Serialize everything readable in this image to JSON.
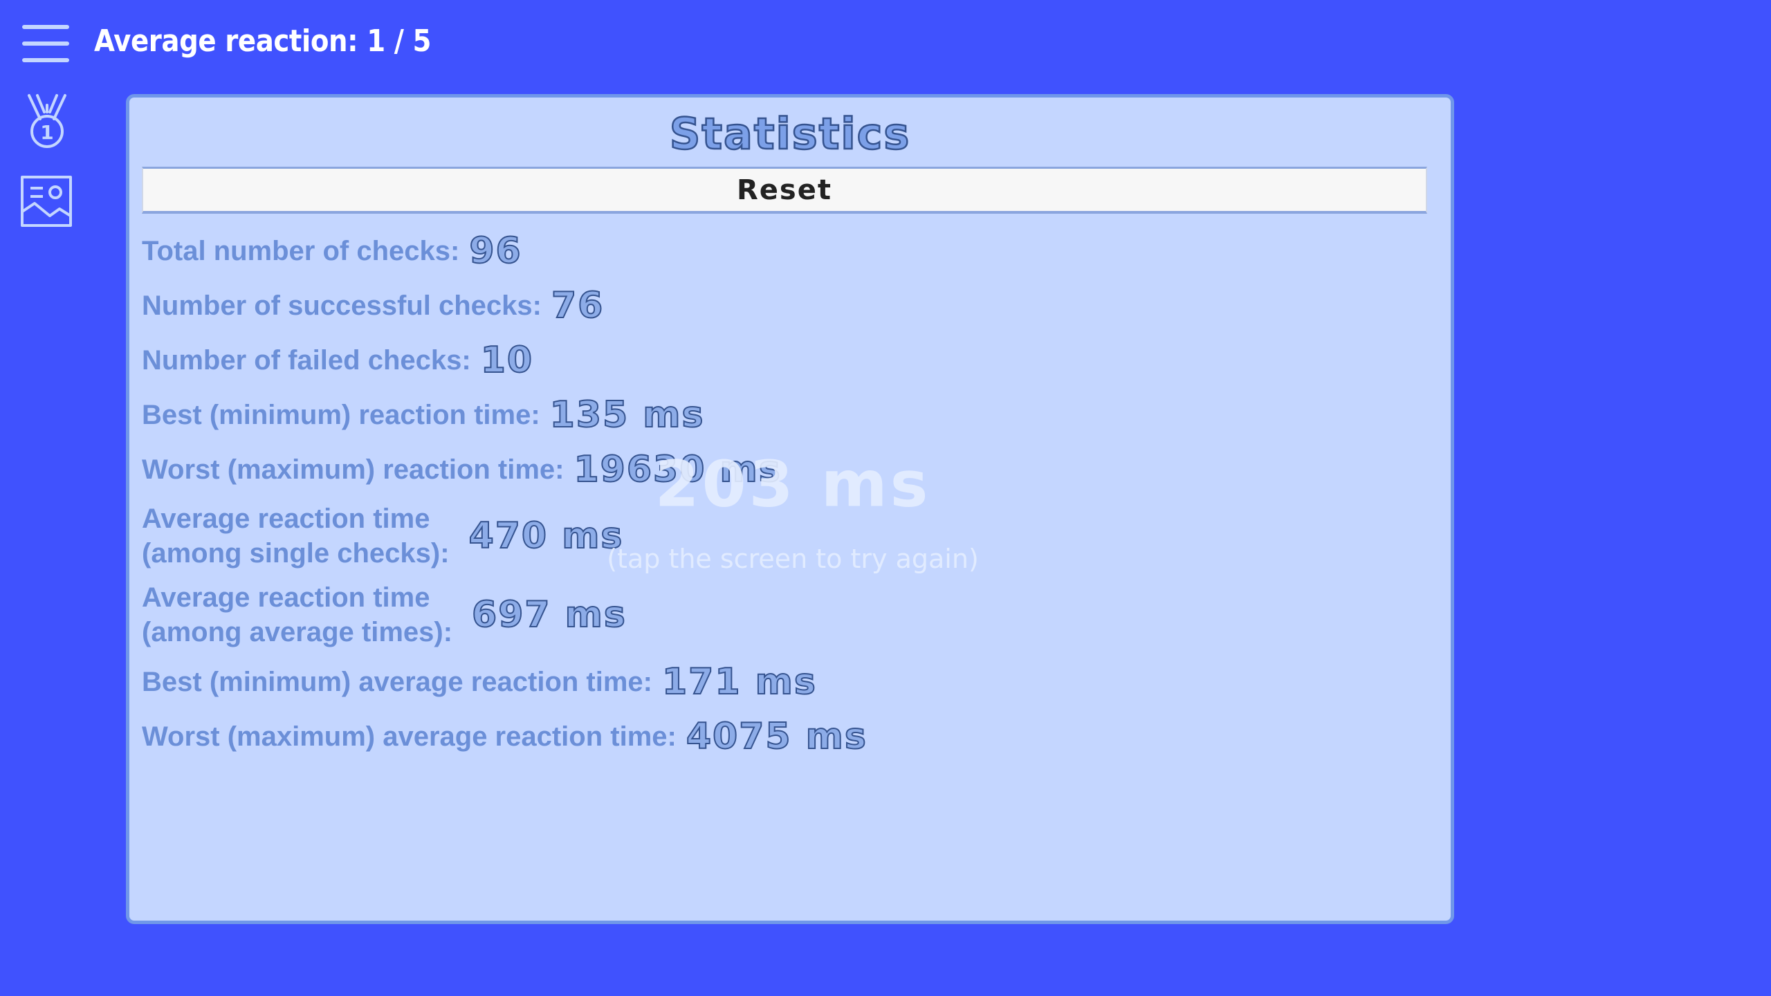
{
  "header": {
    "title": "Average reaction: 1 / 5",
    "menu_icon": "hamburger-menu-icon"
  },
  "sidebar": {
    "items": [
      {
        "icon": "medal-icon"
      },
      {
        "icon": "image-gallery-icon"
      }
    ]
  },
  "result": {
    "time": "203 ms",
    "hint": "(tap the screen to try again)"
  },
  "statistics": {
    "title": "Statistics",
    "reset_label": "Reset",
    "rows": [
      {
        "label": "Total number of checks:",
        "value": "96"
      },
      {
        "label": "Number of successful checks:",
        "value": "76"
      },
      {
        "label": "Number of failed checks:",
        "value": "10"
      },
      {
        "label": "Best (minimum) reaction time:",
        "value": "135 ms"
      },
      {
        "label": "Worst (maximum) reaction time:",
        "value": "19630 ms"
      },
      {
        "label": "Average reaction time\n(among single checks):",
        "value": "470 ms"
      },
      {
        "label": "Average reaction time\n(among average times):",
        "value": "697 ms"
      },
      {
        "label": "Best (minimum) average reaction time:",
        "value": "171 ms"
      },
      {
        "label": "Worst (maximum) average reaction time:",
        "value": "4075 ms"
      }
    ]
  },
  "colors": {
    "background": "#4052fe",
    "panel": "#c4d6ff",
    "panel_border": "#7097e9",
    "label_text": "#6b8fd8",
    "value_outline": "#35538f"
  }
}
